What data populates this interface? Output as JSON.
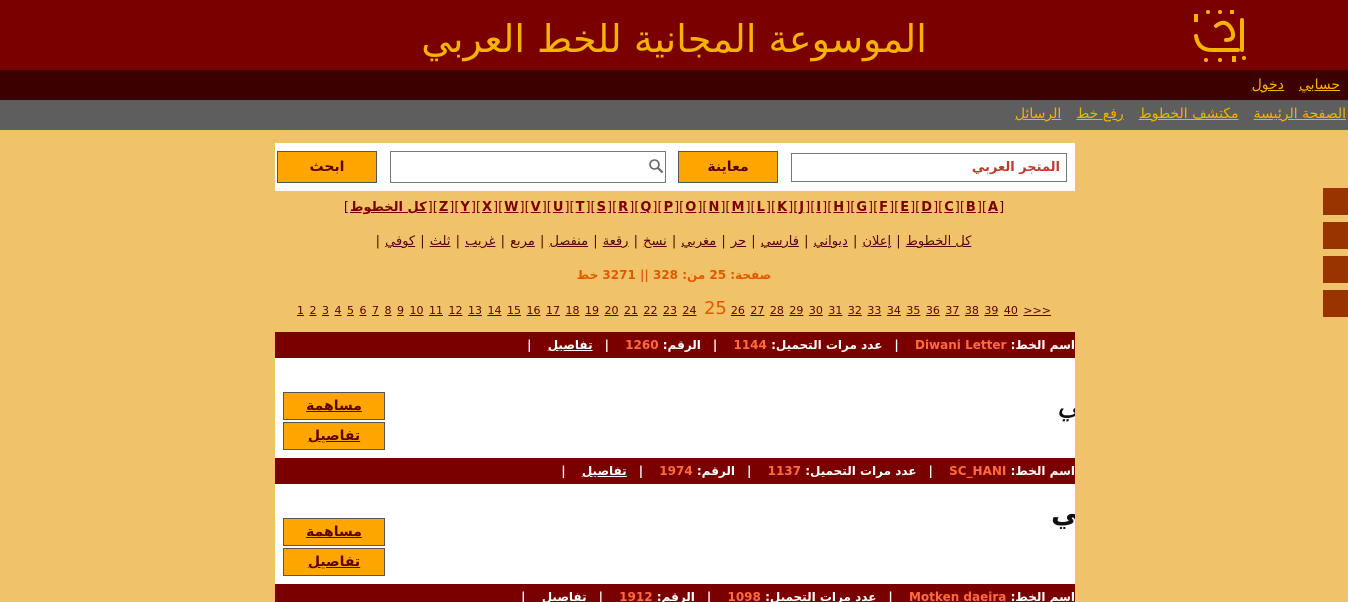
{
  "header": {
    "title": "الموسوعة المجانية للخط العربي"
  },
  "userbar": {
    "items": [
      "حسابي",
      "دخول"
    ]
  },
  "navbar": {
    "items": [
      "الصفحة الرئيسة",
      "مكتشف الخطوط",
      "رفع خط",
      "الرسائل"
    ]
  },
  "search": {
    "preview_value": "المتجر العربي",
    "preview_button": "معاينة",
    "search_value": "",
    "search_button": "ابحث"
  },
  "letters": [
    "A",
    "B",
    "C",
    "D",
    "E",
    "F",
    "G",
    "H",
    "I",
    "J",
    "K",
    "L",
    "M",
    "N",
    "O",
    "P",
    "Q",
    "R",
    "S",
    "T",
    "U",
    "V",
    "W",
    "X",
    "Y",
    "Z",
    "كل الخطوط"
  ],
  "styles": [
    "كل الخطوط",
    "إعلان",
    "ديواني",
    "فارسي",
    "حر",
    "مغربي",
    "نسخ",
    "رقعة",
    "منفصل",
    "مربع",
    "غريب",
    "ثلث",
    "كوفي"
  ],
  "pageinfo": {
    "text": "صفحة: 25 من: 328 || 3271 خط"
  },
  "pager": {
    "before": [
      "1",
      "2",
      "3",
      "4",
      "5",
      "6",
      "7",
      "8",
      "9",
      "10",
      "11",
      "12",
      "13",
      "14",
      "15",
      "16",
      "17",
      "18",
      "19",
      "20",
      "21",
      "22",
      "23",
      "24"
    ],
    "current": "25",
    "after": [
      "26",
      "27",
      "28",
      "29",
      "30",
      "31",
      "32",
      "33",
      "34",
      "35",
      "36",
      "37",
      "38",
      "39",
      "40"
    ],
    "next": ">>>"
  },
  "labels": {
    "font_name": "اسم الخط:",
    "downloads": "عدد مرات التحميل:",
    "number": "الرقم:",
    "details": "تفاصيل",
    "contribute": "مساهمة",
    "details_button": "تفاصيل"
  },
  "fonts": [
    {
      "name": "Diwani Letter",
      "downloads": "1144",
      "number": "1260",
      "sample_text": "المتجر العربي"
    },
    {
      "name": "SC_HANI",
      "downloads": "1137",
      "number": "1974",
      "sample_text": "المتجر العربي"
    },
    {
      "name": "Motken daeira",
      "downloads": "1098",
      "number": "1912",
      "sample_text": ""
    }
  ],
  "colors": {
    "header_bg": "#7a0000",
    "accent": "#f5b300",
    "page_bg": "#f0c36b",
    "button": "#ffa500"
  },
  "icons": {
    "logo": "calligraphy-logo-icon",
    "search": "magnifier-icon"
  }
}
